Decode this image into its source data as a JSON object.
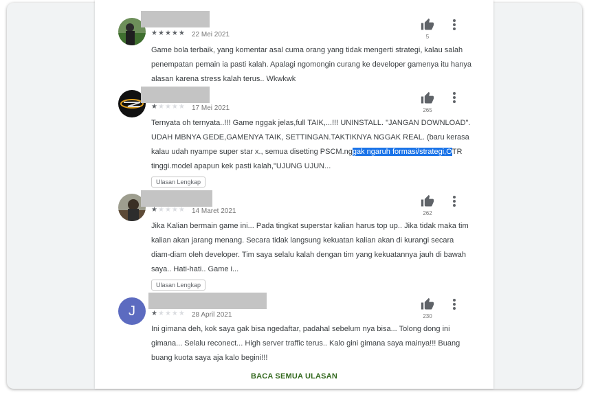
{
  "reviews": [
    {
      "stars": 5,
      "date": "22 Mei 2021",
      "likes": "5",
      "text": "Game bola terbaik, yang komentar asal cuma orang yang tidak mengerti strategi, kalau salah penempatan pemain ia pasti kalah. Apalagi ngomongin curang ke developer gamenya itu hanya alasan karena stress kalah terus.. Wkwkwk"
    },
    {
      "stars": 1,
      "date": "17 Mei 2021",
      "likes": "265",
      "text_before": "Ternyata oh ternyata..!!! Game nggak jelas,full TAIK,...!!! UNINSTALL. \"JANGAN DOWNLOAD\". UDAH MBNYA GEDE,GAMENYA TAIK, SETTINGAN.TAKTIKNYA NGGAK REAL. (baru kerasa kalau udah nyampe super star x., semua disetting PSCM.ng",
      "text_highlight": "gak ngaruh formasi/strategi,O",
      "text_after": "TR tinggi.model apapun kek pasti kalah,\"UJUNG UJUN...",
      "full_label": "Ulasan Lengkap"
    },
    {
      "stars": 1,
      "date": "14 Maret 2021",
      "likes": "262",
      "text": "Jika Kalian bermain game ini... Pada tingkat superstar kalian harus top up.. Jika tidak maka tim kalian akan jarang menang. Secara tidak langsung kekuatan kalian akan di kurangi secara diam-diam oleh developer. Tim saya selalu kalah dengan tim yang kekuatannya jauh di bawah saya.. Hati-hati.. Game i...",
      "full_label": "Ulasan Lengkap"
    },
    {
      "stars": 1,
      "date": "28 April 2021",
      "likes": "230",
      "avatar_letter": "J",
      "avatar_color": "#5c6bc0",
      "text": "Ini gimana deh, kok saya gak bisa ngedaftar, padahal sebelum nya bisa... Tolong dong ini gimana... Selalu reconect... High server traffic terus.. Kalo gini gimana saya mainya!!! Buang buang kuota saya aja kalo begini!!!"
    }
  ],
  "read_all_label": "BACA SEMUA ULASAN",
  "colors": {
    "accent_green": "#33691e",
    "highlight": "#1a73e8"
  },
  "icons": {
    "thumb": "thumbs-up-icon",
    "more": "more-vert-icon"
  }
}
